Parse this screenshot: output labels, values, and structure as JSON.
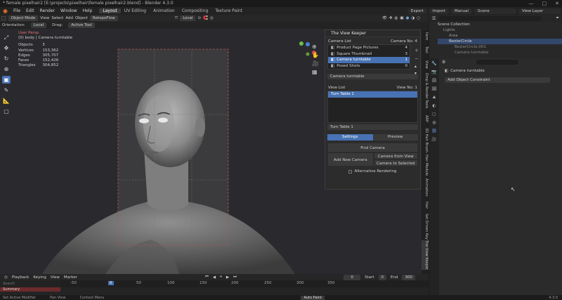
{
  "window": {
    "title": "* female pixelhair2 [E:\\projects\\pixelhair\\female pixelhair2.blend] - Blender 4.3.0",
    "controls": [
      "—",
      "□",
      "✕"
    ]
  },
  "menu": [
    "File",
    "Edit",
    "Render",
    "Window",
    "Help"
  ],
  "workspaces": [
    "Layout",
    "UV Editing",
    "Animation",
    "Compositing",
    "Texture Paint"
  ],
  "workspace_active": "Layout",
  "topright": {
    "export": "Export",
    "import": "Import",
    "manual": "Manual",
    "scene": "Scene",
    "view_layer": "View Layer"
  },
  "toolheader": {
    "mode": "Object Mode",
    "items": [
      "View",
      "Select",
      "Add",
      "Object"
    ],
    "retopo": "RetopoFlow",
    "transform": "Local"
  },
  "headerrow2": {
    "orientation_label": "Orientation:",
    "orientation": "Local",
    "drag_label": "Drag:",
    "drag": "Active Tool"
  },
  "stats": {
    "view": "User Persp",
    "collection": "(0) body | Camera turntable",
    "objects_label": "Objects",
    "objects": "5",
    "vertices_label": "Vertices",
    "vertices": "153,362",
    "edges_label": "Edges",
    "edges": "305,707",
    "faces_label": "Faces",
    "faces": "152,426",
    "triangles_label": "Triangles",
    "triangles": "304,852"
  },
  "panel": {
    "title": "The View Keeper",
    "camera_list_label": "Camera List",
    "camera_no_label": "Camera No:",
    "camera_no": "4",
    "cameras": [
      {
        "name": "Product Page Pictures",
        "num": "4"
      },
      {
        "name": "Square Thumbnail",
        "num": "3"
      },
      {
        "name": "Camera turntable",
        "num": "1"
      },
      {
        "name": "Posed Shots",
        "num": "0"
      }
    ],
    "selected_camera": "Camera turntable",
    "view_list_label": "View List",
    "view_no_label": "View No:",
    "view_no": "1",
    "views": [
      "Turn Table 1"
    ],
    "selected_view": "Turn Table 1",
    "tab_settings": "Settings",
    "tab_preview": "Preview",
    "find_camera": "Find Camera",
    "add_new_camera": "Add New Camera",
    "camera_from_view": "Camera from View",
    "camera_to_selected": "Camera to Selected",
    "alt_rendering": "Alternative Rendering"
  },
  "sidebar_tabs": [
    "Item",
    "Tool",
    "View",
    "Drop & Render",
    "Tools",
    "ARP",
    "3D Hair Brush",
    "Hair Module",
    "Animation",
    "Hair",
    "Set Driven Key",
    "The View Keeper"
  ],
  "outliner": {
    "title": "Scene Collection",
    "items": [
      "Lights",
      "Area",
      "BezierCircle",
      "BezierCircle.001",
      "Camera turntable"
    ]
  },
  "properties": {
    "object": "Camera turntable",
    "add_constraint": "Add Object Constraint"
  },
  "timeline": {
    "menu": [
      "Playback",
      "Keying",
      "View",
      "Marker"
    ],
    "current_frame": "0",
    "start_label": "Start",
    "start": "0",
    "end_label": "End",
    "end": "300",
    "ticks": [
      "-50",
      "0",
      "50",
      "100",
      "150",
      "200",
      "250",
      "300",
      "350"
    ],
    "summary": "Summary",
    "search_placeholder": "Search"
  },
  "status": {
    "left": "Set Active Modifier",
    "mid": "Pan View",
    "right": "Context Menu",
    "action": "Auto Paint",
    "version": "4.3.0"
  },
  "colors": {
    "accent": "#4772b3",
    "bg": "#2a2a2e"
  }
}
